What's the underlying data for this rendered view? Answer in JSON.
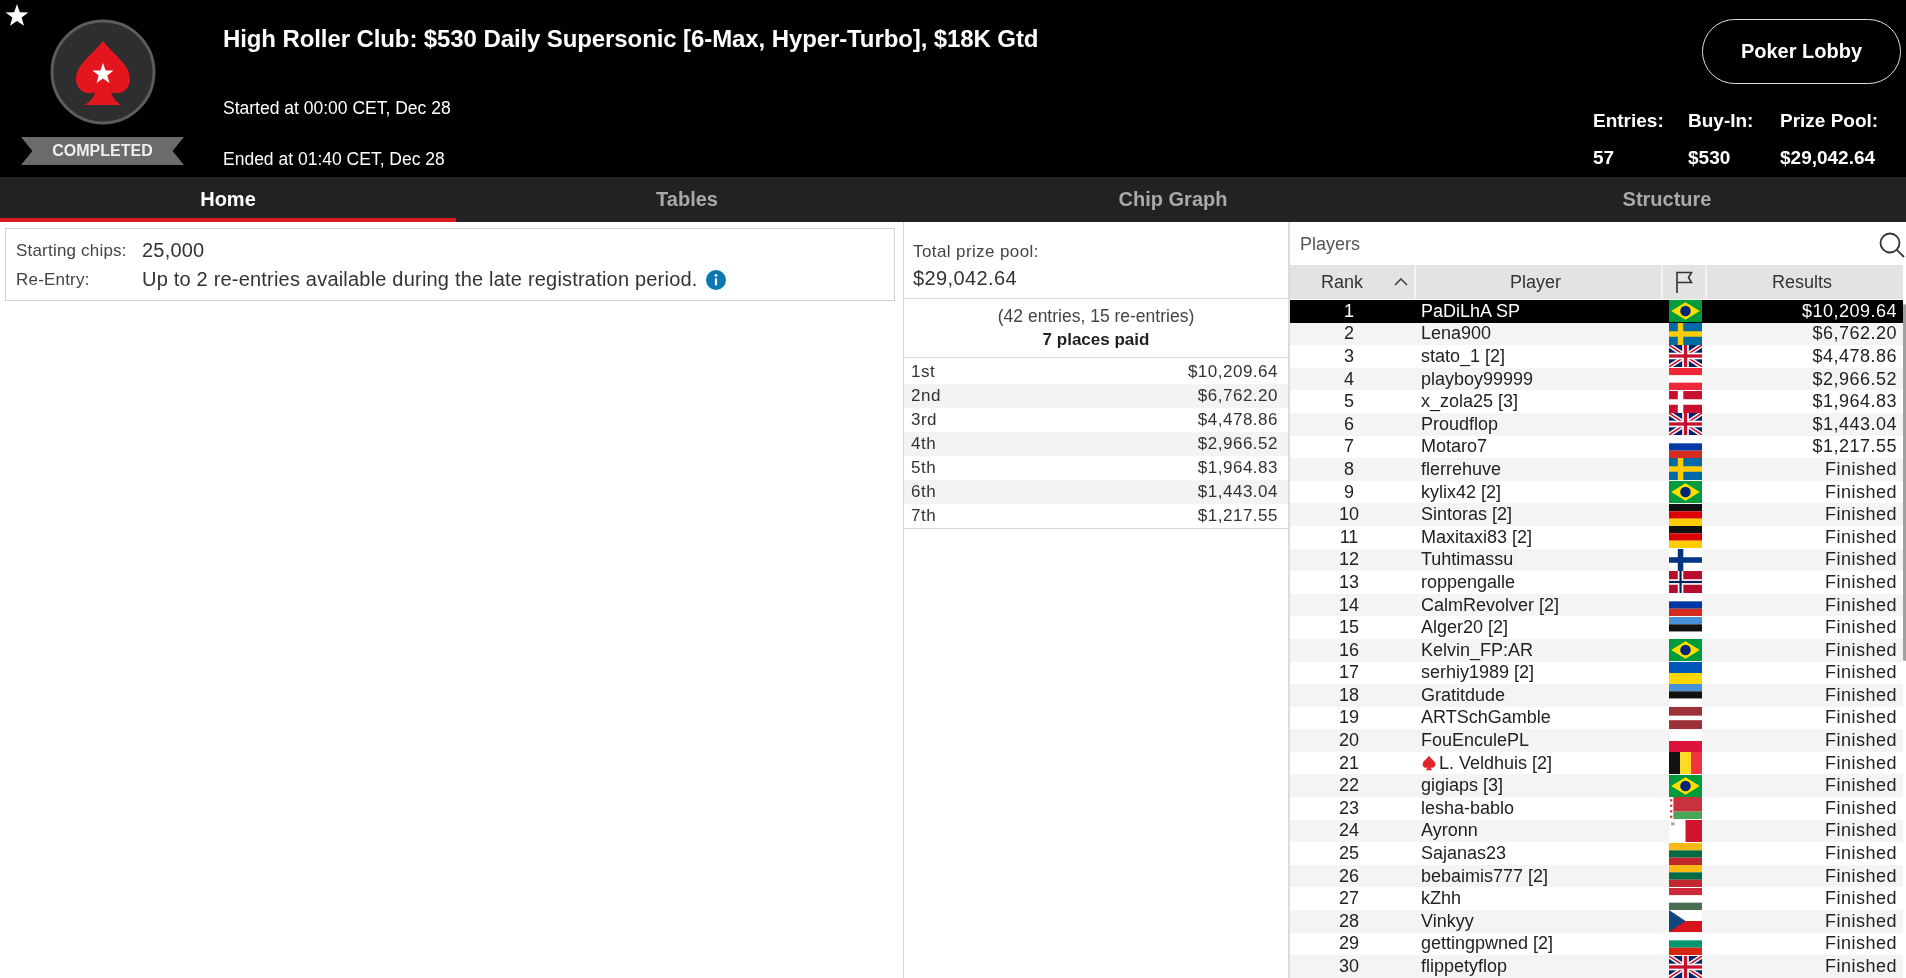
{
  "header": {
    "status": "COMPLETED",
    "title": "High Roller Club: $530 Daily Supersonic [6-Max, Hyper-Turbo], $18K Gtd",
    "started": "Started at 00:00 CET, Dec 28",
    "ended": "Ended at 01:40 CET, Dec 28",
    "lobby_button": "Poker Lobby",
    "stats": [
      {
        "label": "Entries:",
        "value": "57"
      },
      {
        "label": "Buy-In:",
        "value": "$530"
      },
      {
        "label": "Prize Pool:",
        "value": "$29,042.64"
      }
    ]
  },
  "tabs": [
    {
      "label": "Home",
      "selected": true
    },
    {
      "label": "Tables",
      "selected": false
    },
    {
      "label": "Chip Graph",
      "selected": false
    },
    {
      "label": "Structure",
      "selected": false
    }
  ],
  "details": [
    {
      "label": "Starting chips:",
      "value": "25,000",
      "info": false
    },
    {
      "label": "Re-Entry:",
      "value": "Up to 2 re-entries available during the late registration period.",
      "info": true
    }
  ],
  "prize_summary": {
    "label": "Total prize pool:",
    "value": "$29,042.64",
    "entries_note": "(42 entries, 15 re-entries)",
    "places_paid": "7 places paid"
  },
  "payouts": [
    {
      "place": "1st",
      "amount": "$10,209.64"
    },
    {
      "place": "2nd",
      "amount": "$6,762.20"
    },
    {
      "place": "3rd",
      "amount": "$4,478.86"
    },
    {
      "place": "4th",
      "amount": "$2,966.52"
    },
    {
      "place": "5th",
      "amount": "$1,964.83"
    },
    {
      "place": "6th",
      "amount": "$1,443.04"
    },
    {
      "place": "7th",
      "amount": "$1,217.55"
    }
  ],
  "players": {
    "title": "Players",
    "columns": [
      {
        "kind": "text",
        "label": "Rank",
        "sorted": true
      },
      {
        "kind": "text",
        "label": "Player",
        "sorted": false
      },
      {
        "kind": "flag",
        "sorted": false
      },
      {
        "kind": "text",
        "label": "Results",
        "sorted": false
      }
    ],
    "rows": [
      {
        "rank": "1",
        "name": "PaDiLhA SP",
        "flag": {
          "kind": "brazil"
        },
        "result": "$10,209.64",
        "selected": true,
        "spade": false
      },
      {
        "rank": "2",
        "name": "Lena900",
        "flag": {
          "kind": "sweden"
        },
        "result": "$6,762.20",
        "selected": false,
        "spade": false
      },
      {
        "rank": "3",
        "name": "stato_1 [2]",
        "flag": {
          "kind": "britain"
        },
        "result": "$4,478.86",
        "selected": false,
        "spade": false
      },
      {
        "rank": "4",
        "name": "playboy99999",
        "flag": {
          "kind": "austria"
        },
        "result": "$2,966.52",
        "selected": false,
        "spade": false
      },
      {
        "rank": "5",
        "name": "x_zola25 [3]",
        "flag": {
          "kind": "denmark"
        },
        "result": "$1,964.83",
        "selected": false,
        "spade": false
      },
      {
        "rank": "6",
        "name": "Proudflop",
        "flag": {
          "kind": "britain"
        },
        "result": "$1,443.04",
        "selected": false,
        "spade": false
      },
      {
        "rank": "7",
        "name": "Motaro7",
        "flag": {
          "kind": "russia"
        },
        "result": "$1,217.55",
        "selected": false,
        "spade": false
      },
      {
        "rank": "8",
        "name": "flerrehuve",
        "flag": {
          "kind": "sweden"
        },
        "result": "Finished",
        "selected": false,
        "spade": false
      },
      {
        "rank": "9",
        "name": "kylix42 [2]",
        "flag": {
          "kind": "brazil"
        },
        "result": "Finished",
        "selected": false,
        "spade": false
      },
      {
        "rank": "10",
        "name": "Sintoras [2]",
        "flag": {
          "kind": "germany"
        },
        "result": "Finished",
        "selected": false,
        "spade": false
      },
      {
        "rank": "11",
        "name": "Maxitaxi83 [2]",
        "flag": {
          "kind": "germany"
        },
        "result": "Finished",
        "selected": false,
        "spade": false
      },
      {
        "rank": "12",
        "name": "Tuhtimassu",
        "flag": {
          "kind": "finland"
        },
        "result": "Finished",
        "selected": false,
        "spade": false
      },
      {
        "rank": "13",
        "name": "roppengalle",
        "flag": {
          "kind": "norway"
        },
        "result": "Finished",
        "selected": false,
        "spade": false
      },
      {
        "rank": "14",
        "name": "CalmRevolver [2]",
        "flag": {
          "kind": "russia"
        },
        "result": "Finished",
        "selected": false,
        "spade": false
      },
      {
        "rank": "15",
        "name": "Alger20 [2]",
        "flag": {
          "kind": "estonia"
        },
        "result": "Finished",
        "selected": false,
        "spade": false
      },
      {
        "rank": "16",
        "name": "Kelvin_FP:AR",
        "flag": {
          "kind": "brazil"
        },
        "result": "Finished",
        "selected": false,
        "spade": false
      },
      {
        "rank": "17",
        "name": "serhiy1989 [2]",
        "flag": {
          "kind": "ukraine"
        },
        "result": "Finished",
        "selected": false,
        "spade": false
      },
      {
        "rank": "18",
        "name": "Gratitdude",
        "flag": {
          "kind": "estonia"
        },
        "result": "Finished",
        "selected": false,
        "spade": false
      },
      {
        "rank": "19",
        "name": "ARTSchGamble",
        "flag": {
          "kind": "latvia"
        },
        "result": "Finished",
        "selected": false,
        "spade": false
      },
      {
        "rank": "20",
        "name": "FouEnculePL",
        "flag": {
          "kind": "poland"
        },
        "result": "Finished",
        "selected": false,
        "spade": false
      },
      {
        "rank": "21",
        "name": "L. Veldhuis [2]",
        "flag": {
          "kind": "belgium"
        },
        "result": "Finished",
        "selected": false,
        "spade": true
      },
      {
        "rank": "22",
        "name": "gigiaps [3]",
        "flag": {
          "kind": "brazil"
        },
        "result": "Finished",
        "selected": false,
        "spade": false
      },
      {
        "rank": "23",
        "name": "lesha-bablo",
        "flag": {
          "kind": "belarus"
        },
        "result": "Finished",
        "selected": false,
        "spade": false
      },
      {
        "rank": "24",
        "name": "Ayronn",
        "flag": {
          "kind": "malta"
        },
        "result": "Finished",
        "selected": false,
        "spade": false
      },
      {
        "rank": "25",
        "name": "Sajanas23",
        "flag": {
          "kind": "lithuania"
        },
        "result": "Finished",
        "selected": false,
        "spade": false
      },
      {
        "rank": "26",
        "name": "bebaimis777 [2]",
        "flag": {
          "kind": "lithuania"
        },
        "result": "Finished",
        "selected": false,
        "spade": false
      },
      {
        "rank": "27",
        "name": "kZhh",
        "flag": {
          "kind": "hungary"
        },
        "result": "Finished",
        "selected": false,
        "spade": false
      },
      {
        "rank": "28",
        "name": "Vinkyy",
        "flag": {
          "kind": "czechia"
        },
        "result": "Finished",
        "selected": false,
        "spade": false
      },
      {
        "rank": "29",
        "name": "gettingpwned [2]",
        "flag": {
          "kind": "bulgaria"
        },
        "result": "Finished",
        "selected": false,
        "spade": false
      },
      {
        "rank": "30",
        "name": "flippetyflop",
        "flag": {
          "kind": "britain"
        },
        "result": "Finished",
        "selected": false,
        "spade": false
      }
    ]
  }
}
